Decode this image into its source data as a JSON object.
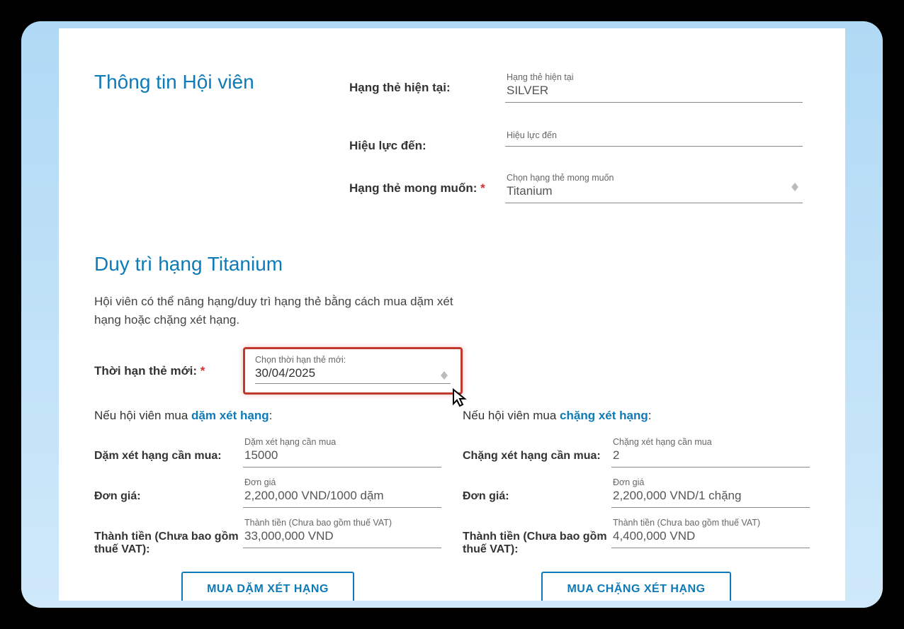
{
  "section1": {
    "title": "Thông tin Hội viên",
    "current_tier_label": "Hạng thẻ hiện tại:",
    "current_tier_float": "Hạng thẻ hiện tại",
    "current_tier_value": "SILVER",
    "valid_label": "Hiệu lực đến:",
    "valid_float": "Hiệu lực đến",
    "valid_value": "",
    "desired_label": "Hạng thẻ mong muốn:",
    "desired_req": "*",
    "desired_float": "Chọn hạng thẻ mong muốn",
    "desired_value": "Titanium"
  },
  "section2": {
    "title": "Duy trì hạng Titanium",
    "desc": "Hội viên có thể nâng hạng/duy trì hạng thẻ bằng cách mua dặm xét hạng hoặc chặng xét hạng.",
    "term_label": "Thời hạn thẻ mới:",
    "term_req": "*",
    "term_float": "Chọn thời hạn thẻ mới:",
    "term_value": "30/04/2025"
  },
  "miles": {
    "heading_prefix": "Nếu hội viên mua ",
    "heading_link": "dặm xét hạng",
    "heading_suffix": ":",
    "need_label": "Dặm xét hạng cần mua:",
    "need_float": "Dặm xét hạng cần mua",
    "need_value": "15000",
    "price_label": "Đơn giá:",
    "price_float": "Đơn giá",
    "price_value": "2,200,000 VND/1000 dặm",
    "total_label": "Thành tiền (Chưa bao gồm thuế VAT):",
    "total_float": "Thành tiền (Chưa bao gồm thuế VAT)",
    "total_value": "33,000,000 VND",
    "button": "MUA DẶM XÉT HẠNG"
  },
  "segments": {
    "heading_prefix": "Nếu hội viên mua ",
    "heading_link": "chặng xét hạng",
    "heading_suffix": ":",
    "need_label": "Chặng xét hạng cần mua:",
    "need_float": "Chặng xét hạng cần mua",
    "need_value": "2",
    "price_label": "Đơn giá:",
    "price_float": "Đơn giá",
    "price_value": "2,200,000 VND/1 chặng",
    "total_label": "Thành tiền (Chưa bao gồm thuế VAT):",
    "total_float": "Thành tiền (Chưa bao gồm thuế VAT)",
    "total_value": "4,400,000 VND",
    "button": "MUA CHẶNG XÉT HẠNG"
  }
}
